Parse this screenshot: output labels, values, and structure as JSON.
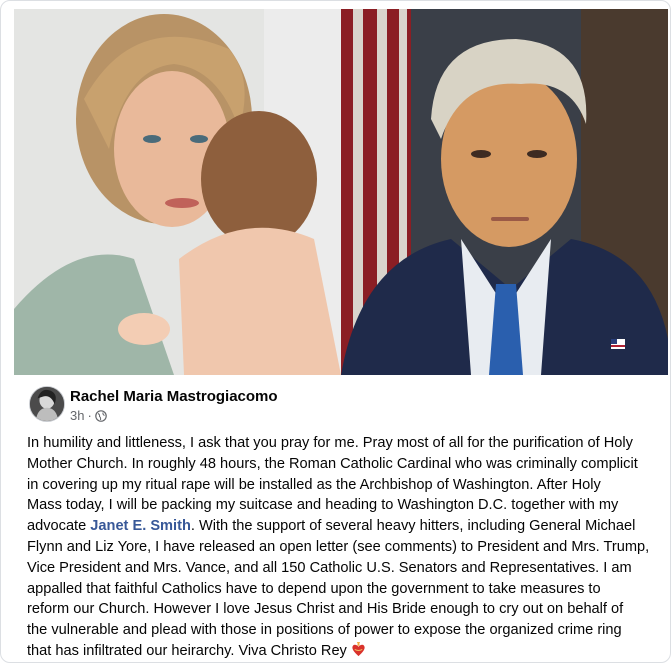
{
  "post": {
    "author": "Rachel Maria Mastrogiacomo",
    "time": "3h",
    "separator": "·",
    "privacy_icon": "globe-icon",
    "images": [
      {
        "subject": "photo-woman-holding-baby"
      },
      {
        "subject": "photo-man-in-suit-portrait"
      }
    ],
    "text_lines": [
      "In humility and littleness, I ask that you pray for me. Pray most of all for the purification of Holy",
      "Mother Church. In roughly 48 hours, the Roman Catholic Cardinal who was criminally complicit",
      "in covering up my ritual rape will be installed as the Archbishop of Washington. After Holy",
      "Mass today, I will be packing my suitcase and heading to Washington D.C. together with my"
    ],
    "line5_before": "advocate ",
    "mention": "Janet E. Smith",
    "line5_after": ". With the support of several heavy hitters, including General Michael",
    "text_lines_2": [
      "Flynn and Liz Yore, I have released an open letter (see comments) to President and Mrs. Trump,",
      "Vice President and Mrs. Vance, and all 150 Catholic U.S. Senators and Representatives. I am",
      "appalled that faithful Catholics have to depend upon the government to take measures to",
      "reform our Church. However I love Jesus Christ and His Bride enough to cry out on behalf of",
      "the vulnerable and plead with those in positions of power to expose the organized crime ring"
    ],
    "last_line": "that has infiltrated our heirarchy. Viva Christo Rey",
    "end_emoji": "sacred-heart-icon"
  },
  "colors": {
    "mention": "#385898",
    "meta": "#65676b",
    "text": "#050505"
  }
}
